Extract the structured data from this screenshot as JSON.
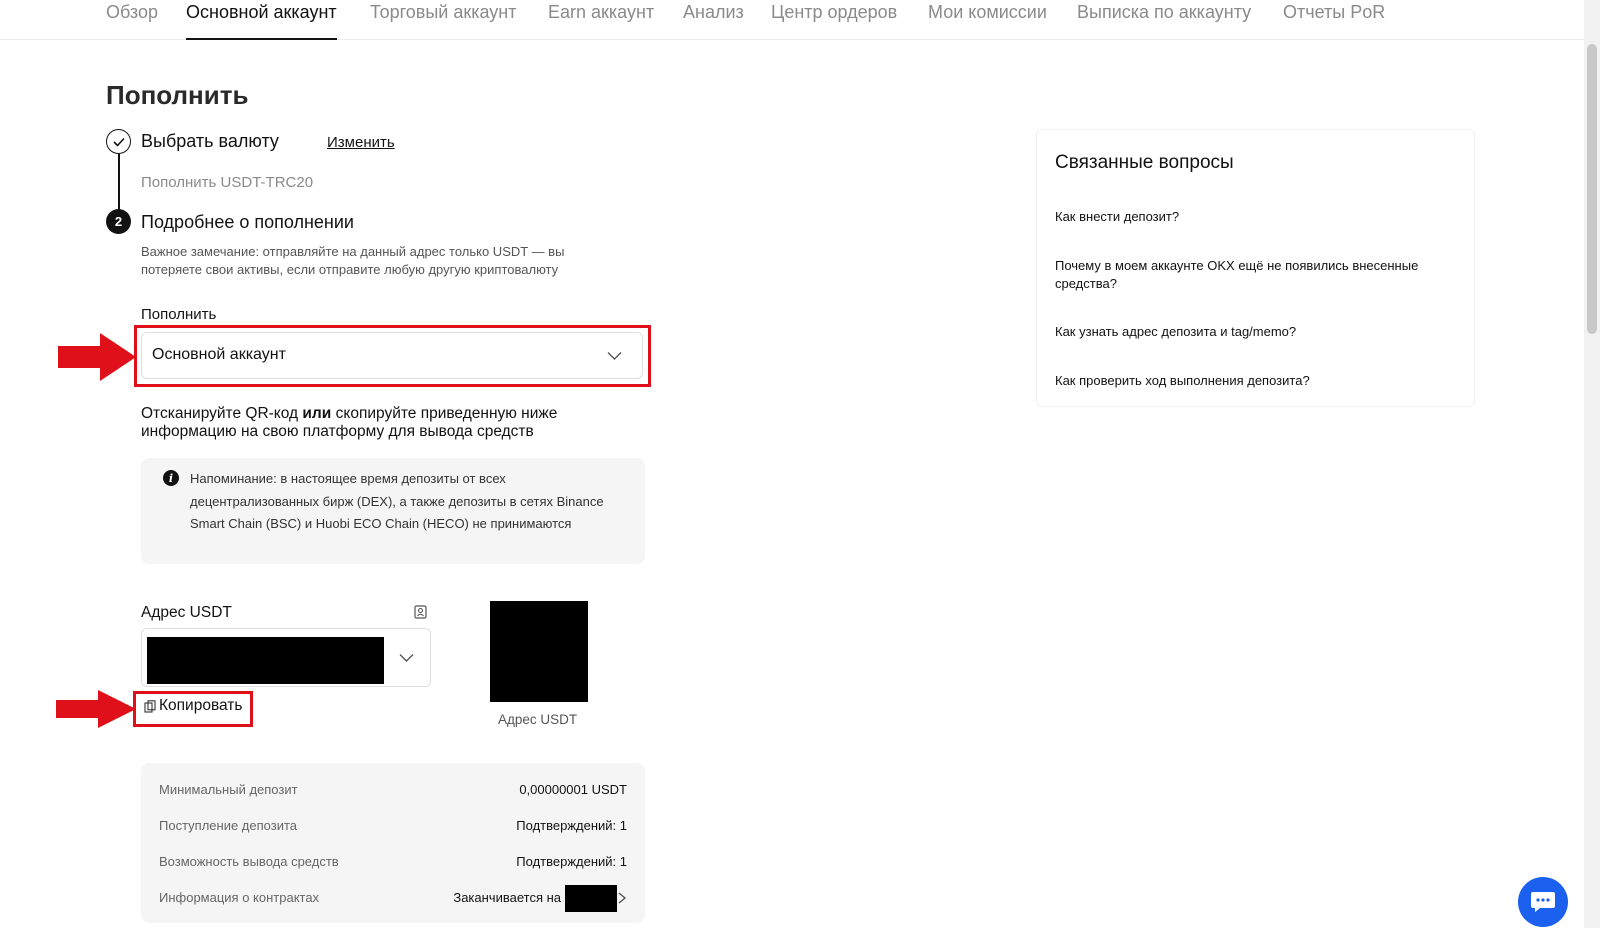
{
  "nav": {
    "tabs": [
      {
        "label": "Обзор"
      },
      {
        "label": "Основной аккаунт"
      },
      {
        "label": "Торговый аккаунт"
      },
      {
        "label": "Earn аккаунт"
      },
      {
        "label": "Анализ"
      },
      {
        "label": "Центр ордеров"
      },
      {
        "label": "Мои комиссии"
      },
      {
        "label": "Выписка по аккаунту"
      },
      {
        "label": "Отчеты PoR"
      }
    ],
    "active_tab": "Основной аккаунт"
  },
  "page": {
    "title": "Пополнить"
  },
  "steps": {
    "step1": {
      "title": "Выбрать валюту",
      "change_label": "Изменить",
      "subtitle": "Пополнить USDT-TRC20",
      "status": "check-icon"
    },
    "step2": {
      "number": "2",
      "title": "Подробнее о пополнении",
      "note": "Важное замечание: отправляйте на данный адрес только USDT — вы потеряете свои активы, если отправите любую другую криптовалюту"
    }
  },
  "deposit_to": {
    "label": "Пополнить",
    "value": "Основной аккаунт"
  },
  "scan": {
    "part1": "Отсканируйте QR-код ",
    "bold": "или",
    "part2": " скопируйте приведенную ниже информацию на свою платформу для вывода средств"
  },
  "reminder": {
    "icon": "info-icon",
    "text": "Напоминание: в настоящее время депозиты от всех децентрализованных бирж (DEX), а также депозиты в сетях Binance Smart Chain (BSC) и Huobi ECO Chain (HECO) не принимаются"
  },
  "address": {
    "label": "Адрес USDT",
    "copy_label": "Копировать",
    "qr_caption": "Адрес USDT"
  },
  "details": [
    {
      "key": "Минимальный депозит",
      "value": "0,00000001 USDT"
    },
    {
      "key": "Поступление депозита",
      "value": "Подтверждений: 1"
    },
    {
      "key": "Возможность вывода средств",
      "value": "Подтверждений: 1"
    },
    {
      "key": "Информация о контрактах",
      "value": "Заканчивается на"
    }
  ],
  "faq": {
    "title": "Связанные вопросы",
    "questions": [
      "Как внести депозит?",
      "Почему в моем аккаунте OKX ещё не появились внесенные средства?",
      "Как узнать адрес депозита и tag/memo?",
      "Как проверить ход выполнения депозита?"
    ]
  },
  "colors": {
    "highlight": "#e0101a",
    "chat_button": "#1c60f0",
    "text": "#121212",
    "muted": "#8a8a8a"
  }
}
